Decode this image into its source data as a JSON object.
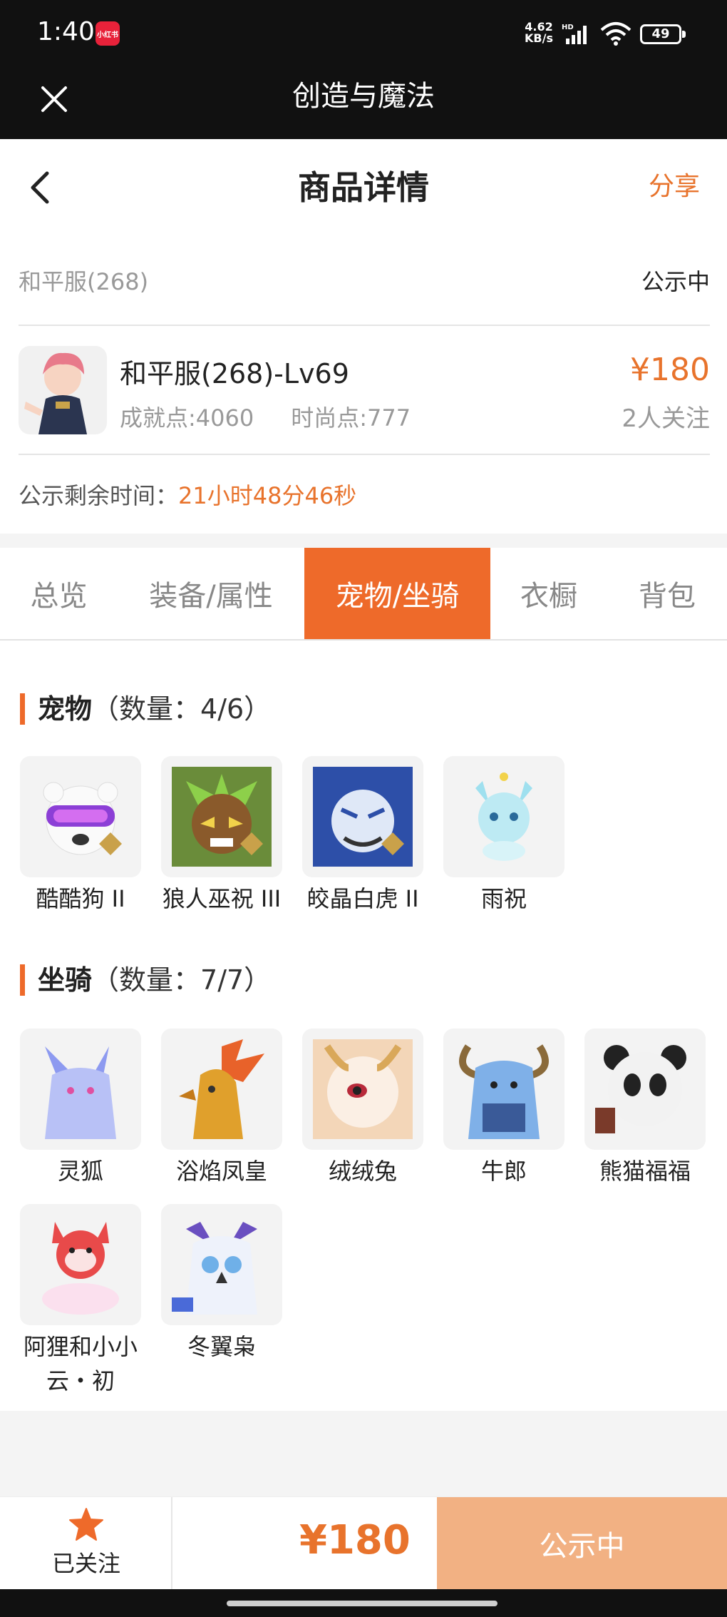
{
  "status_bar": {
    "time": "1:40",
    "app_badge": "小红书",
    "net_speed_value": "4.62",
    "net_speed_unit": "KB/s",
    "net_type": "HD",
    "battery": "49"
  },
  "title_bar": {
    "title": "创造与魔法"
  },
  "header": {
    "title": "商品详情",
    "share_label": "分享"
  },
  "server": {
    "name": "和平服(268)",
    "status": "公示中"
  },
  "character": {
    "name": "和平服(268)-Lv69",
    "achievement": "成就点:4060",
    "fashion": "时尚点:777",
    "price": "¥180",
    "followers": "2人关注"
  },
  "countdown": {
    "label": "公示剩余时间：",
    "value": "21小时48分46秒"
  },
  "tabs": [
    {
      "label": "总览",
      "active": false
    },
    {
      "label": "装备/属性",
      "active": false
    },
    {
      "label": "宠物/坐骑",
      "active": true
    },
    {
      "label": "衣橱",
      "active": false
    },
    {
      "label": "背包",
      "active": false
    }
  ],
  "pets_section": {
    "title": "宠物",
    "count": "（数量：4/6）",
    "items": [
      {
        "name": "酷酷狗 II",
        "tier": "II",
        "color": "#ffffff"
      },
      {
        "name": "狼人巫祝 III",
        "tier": "III",
        "color": "#8a5a2b"
      },
      {
        "name": "皎晶白虎 II",
        "tier": "II",
        "color": "#3f6fd1"
      },
      {
        "name": "雨祝",
        "tier": "",
        "color": "#7fd6e8"
      }
    ]
  },
  "mounts_section": {
    "title": "坐骑",
    "count": "（数量：7/7）",
    "items": [
      {
        "name": "灵狐",
        "color": "#9aa8f2"
      },
      {
        "name": "浴焰凤皇",
        "color": "#e0902c"
      },
      {
        "name": "绒绒兔",
        "color": "#f6dcc4"
      },
      {
        "name": "牛郎",
        "color": "#6fa0d8"
      },
      {
        "name": "熊猫福福",
        "color": "#404040"
      },
      {
        "name": "阿狸和小小云・初",
        "color": "#e84a4a"
      },
      {
        "name": "冬翼枭",
        "color": "#6a7fe0"
      }
    ]
  },
  "bottom_bar": {
    "follow_label": "已关注",
    "price": "¥180",
    "status_button": "公示中"
  },
  "colors": {
    "accent": "#ee6a2a",
    "price": "#e8732c",
    "status_button": "#f2b183"
  }
}
